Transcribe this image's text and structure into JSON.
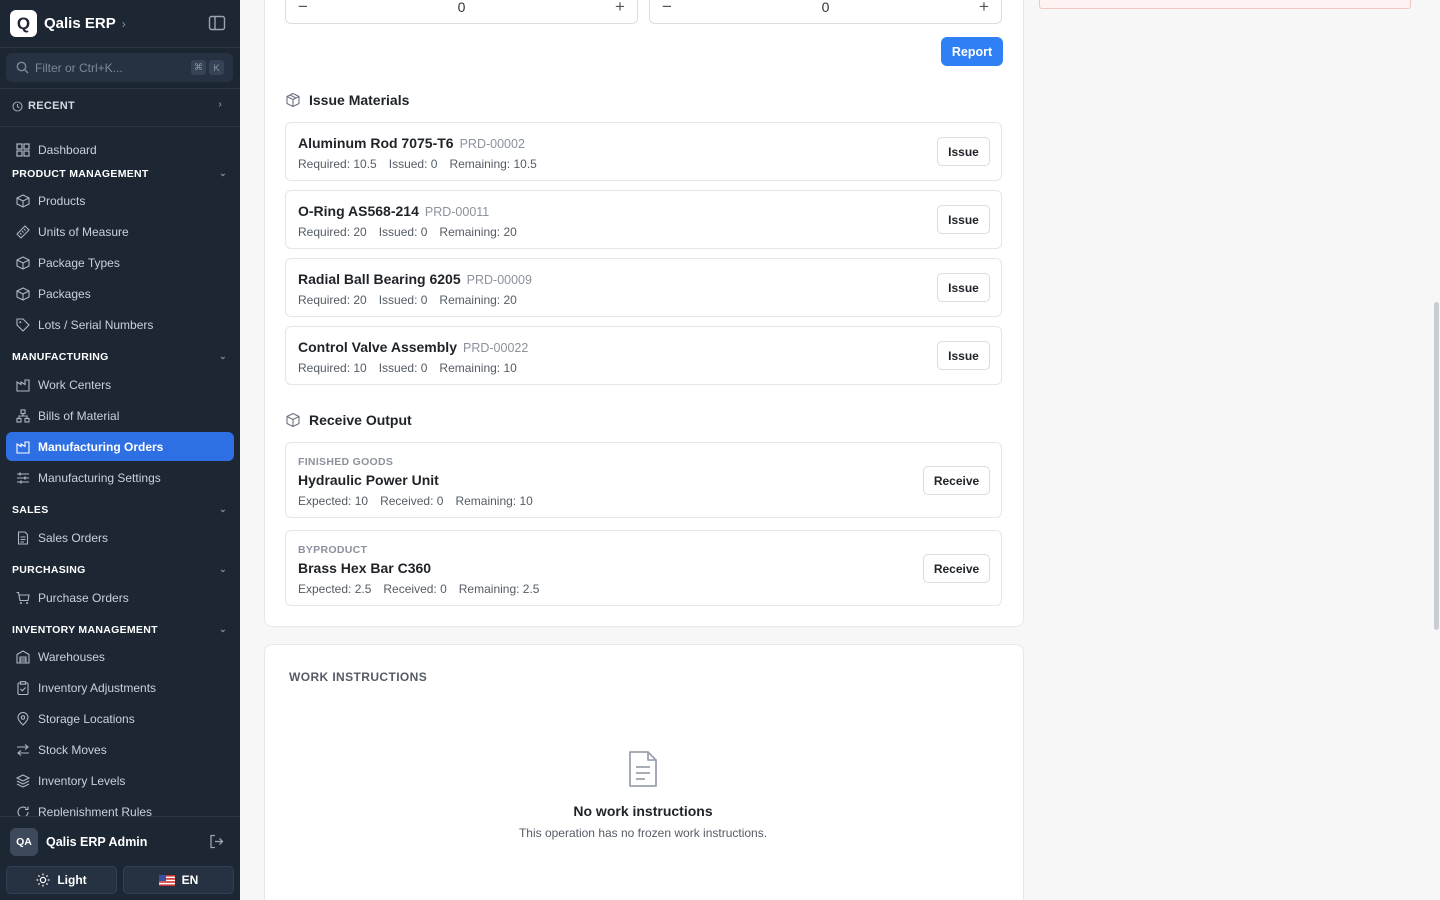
{
  "sidebar": {
    "brand": "Qalis ERP",
    "brand_letter": "Q",
    "search_placeholder": "Filter or Ctrl+K...",
    "shortcut_keys": [
      "⌘",
      "K"
    ],
    "recent_label": "RECENT",
    "dashboard": "Dashboard",
    "sections": {
      "product_management": "PRODUCT MANAGEMENT",
      "manufacturing": "MANUFACTURING",
      "sales": "SALES",
      "purchasing": "PURCHASING",
      "inventory_management": "INVENTORY MANAGEMENT"
    },
    "items": {
      "products": "Products",
      "units": "Units of Measure",
      "package_types": "Package Types",
      "packages": "Packages",
      "lots": "Lots / Serial Numbers",
      "work_centers": "Work Centers",
      "bom": "Bills of Material",
      "mfg_orders": "Manufacturing Orders",
      "mfg_settings": "Manufacturing Settings",
      "sales_orders": "Sales Orders",
      "purchase_orders": "Purchase Orders",
      "warehouses": "Warehouses",
      "inv_adjustments": "Inventory Adjustments",
      "storage_locations": "Storage Locations",
      "stock_moves": "Stock Moves",
      "inv_levels": "Inventory Levels",
      "replenishment": "Replenishment Rules"
    },
    "active_item": "mfg_orders",
    "footer": {
      "avatar_initials": "QA",
      "user_name": "Qalis ERP Admin",
      "theme_label": "Light",
      "lang_label": "EN"
    }
  },
  "report": {
    "steppers": [
      "0",
      "0"
    ],
    "report_button": "Report"
  },
  "issue_materials": {
    "title": "Issue Materials",
    "items": [
      {
        "name": "Aluminum Rod 7075-T6",
        "code": "PRD-00002",
        "required": "Required: 10.5",
        "issued": "Issued: 0",
        "remaining": "Remaining: 10.5",
        "action": "Issue"
      },
      {
        "name": "O-Ring AS568-214",
        "code": "PRD-00011",
        "required": "Required: 20",
        "issued": "Issued: 0",
        "remaining": "Remaining: 20",
        "action": "Issue"
      },
      {
        "name": "Radial Ball Bearing 6205",
        "code": "PRD-00009",
        "required": "Required: 20",
        "issued": "Issued: 0",
        "remaining": "Remaining: 20",
        "action": "Issue"
      },
      {
        "name": "Control Valve Assembly",
        "code": "PRD-00022",
        "required": "Required: 10",
        "issued": "Issued: 0",
        "remaining": "Remaining: 10",
        "action": "Issue"
      }
    ]
  },
  "receive_output": {
    "title": "Receive Output",
    "items": [
      {
        "kind": "FINISHED GOODS",
        "name": "Hydraulic Power Unit",
        "expected": "Expected: 10",
        "received": "Received: 0",
        "remaining": "Remaining: 10",
        "action": "Receive"
      },
      {
        "kind": "BYPRODUCT",
        "name": "Brass Hex Bar C360",
        "expected": "Expected: 2.5",
        "received": "Received: 0",
        "remaining": "Remaining: 2.5",
        "action": "Receive"
      }
    ]
  },
  "work_instructions": {
    "title": "WORK INSTRUCTIONS",
    "empty_title": "No work instructions",
    "empty_desc": "This operation has no frozen work instructions."
  },
  "colors": {
    "sidebar_bg": "#1d2633",
    "accent": "#2f6fe4",
    "report_button": "#2f7ff5",
    "alert_border": "#f2c7c2"
  },
  "icons": {
    "brand": "brand-logo",
    "collapse": "sidebar-collapse-icon",
    "search": "search-icon",
    "recent": "clock-icon",
    "dashboard": "dashboard-grid-icon",
    "products": "box-icon",
    "units": "ruler-icon",
    "package_types": "box-icon",
    "packages": "box-icon",
    "lots": "tag-icon",
    "work_centers": "factory-icon",
    "bom": "hierarchy-icon",
    "mfg_orders": "factory-icon",
    "mfg_settings": "sliders-icon",
    "sales_orders": "document-icon",
    "purchase_orders": "cart-icon",
    "warehouses": "warehouse-icon",
    "inv_adjustments": "clipboard-check-icon",
    "storage_locations": "map-pin-icon",
    "stock_moves": "arrows-swap-icon",
    "inv_levels": "layers-icon",
    "replenishment": "refresh-icon",
    "logout": "logout-icon",
    "theme": "sun-icon",
    "flag": "us-flag-icon",
    "issue_section": "boxes-icon",
    "receive_section": "package-icon",
    "empty_state": "document-icon"
  }
}
